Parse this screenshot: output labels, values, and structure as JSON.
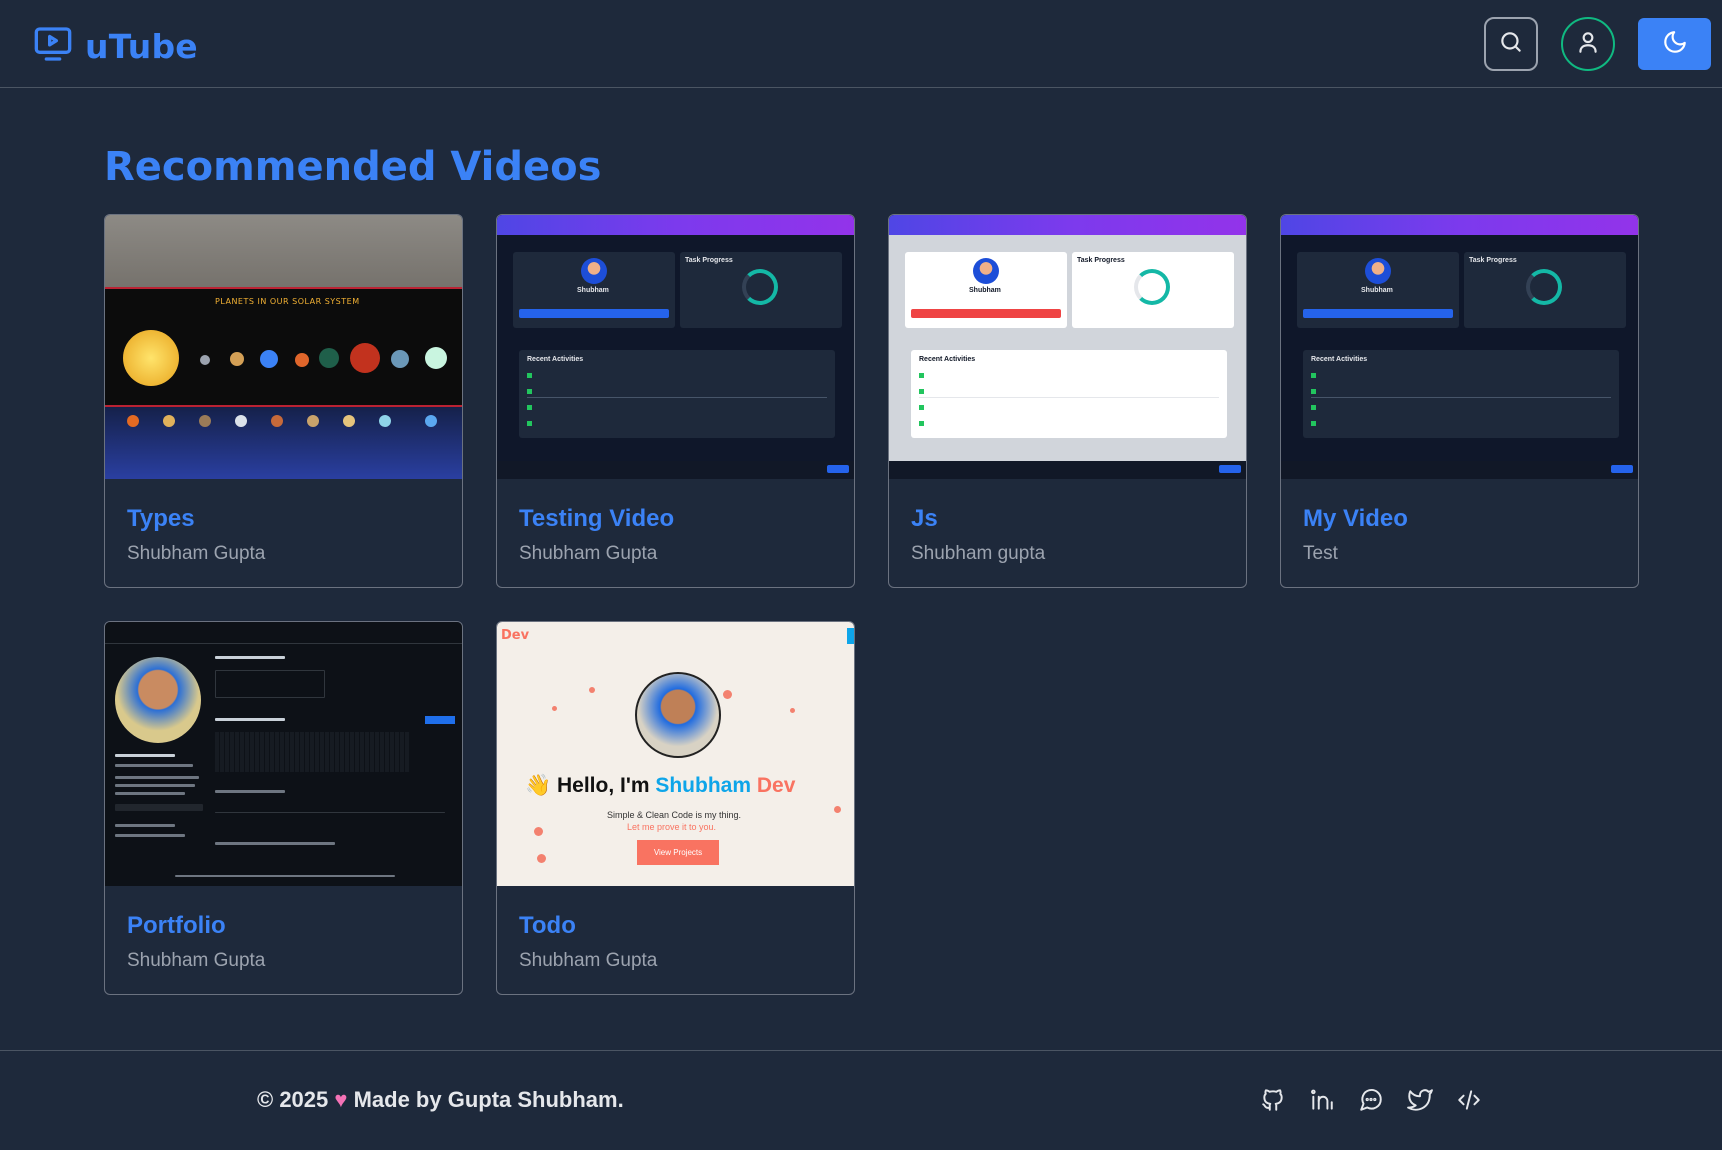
{
  "header": {
    "logo_text": "uTube",
    "icons": [
      "video-play-icon",
      "search-icon",
      "user-icon",
      "moon-icon"
    ]
  },
  "main": {
    "section_title": "Recommended Videos",
    "videos": [
      {
        "title": "Types",
        "author": "Shubham Gupta",
        "thumbnail": "solar-system-poster"
      },
      {
        "title": "Testing Video",
        "author": "Shubham Gupta",
        "thumbnail": "dark-dashboard"
      },
      {
        "title": "Js",
        "author": "Shubham gupta",
        "thumbnail": "light-dashboard"
      },
      {
        "title": "My Video",
        "author": "Test",
        "thumbnail": "dark-dashboard"
      },
      {
        "title": "Portfolio",
        "author": "Shubham Gupta",
        "thumbnail": "github-profile"
      },
      {
        "title": "Todo",
        "author": "Shubham Gupta",
        "thumbnail": "portfolio-hero"
      }
    ],
    "thumb_text": {
      "solar_heading": "PLANETS IN OUR SOLAR SYSTEM",
      "dash_recent": "Recent Activities",
      "dash_task": "Task Progress",
      "dash_pct": "75.0%",
      "dash_user": "Shubham",
      "gh_name": "Gupta Shubham",
      "todo_dev": "Dev",
      "todo_hello": "Hello, I'm ",
      "todo_name1": "Shubham",
      "todo_name2": "Dev",
      "todo_sub1": "Simple & Clean Code is my thing.",
      "todo_sub2": "Let me prove it to you.",
      "todo_btn": "View Projects"
    }
  },
  "footer": {
    "copyright": "© 2025",
    "made_by": "Made by Gupta Shubham.",
    "icons": [
      "github-icon",
      "linkedin-icon",
      "chat-icon",
      "twitter-icon",
      "code-icon"
    ]
  },
  "colors": {
    "background": "#1e293b",
    "accent": "#3b82f6",
    "user_ring": "#10b981",
    "heart": "#f472b6"
  }
}
